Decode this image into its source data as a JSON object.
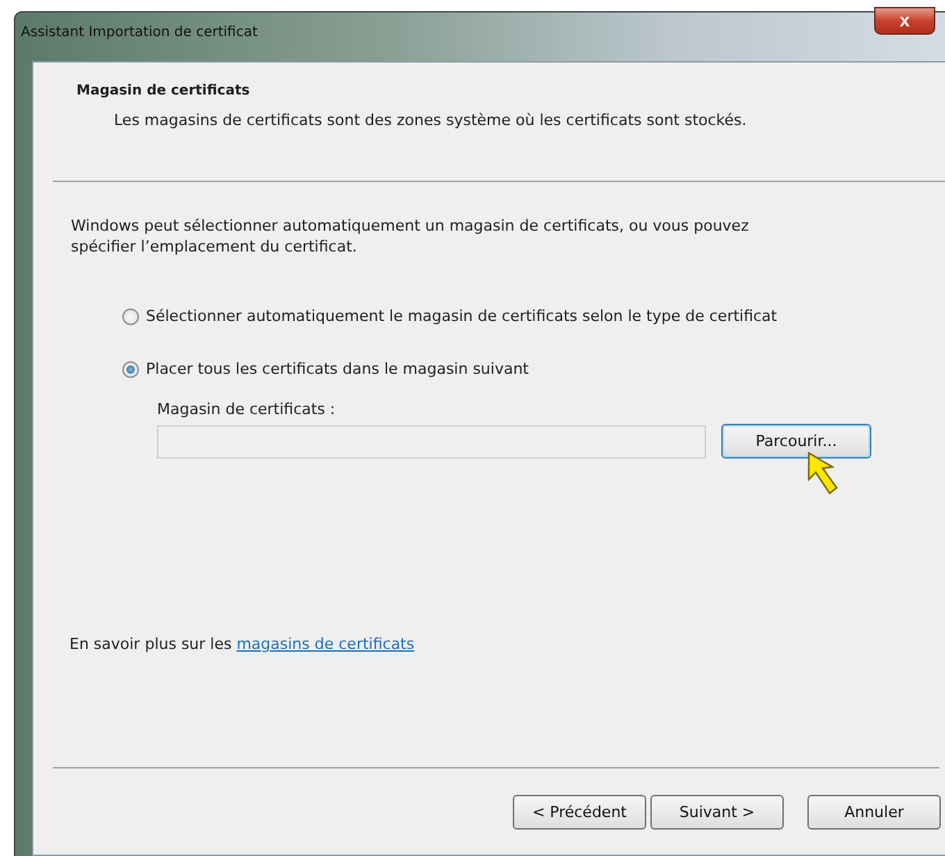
{
  "window": {
    "title": "Assistant Importation de certificat",
    "close": "x"
  },
  "header": {
    "title": "Magasin de certificats",
    "subtitle": "Les magasins de certificats sont des zones système où les certificats sont stockés."
  },
  "intro": "Windows peut sélectionner automatiquement un magasin de certificats, ou vous pouvez spécifier l’emplacement du certificat.",
  "options": [
    {
      "label": "Sélectionner automatiquement le magasin de certificats selon le type de certificat",
      "selected": false
    },
    {
      "label": "Placer tous les certificats dans le magasin suivant",
      "selected": true
    }
  ],
  "store_field": {
    "label": "Magasin de certificats :",
    "browse": "Parcourir..."
  },
  "learn_more": {
    "text": "En savoir plus sur les",
    "link": "magasins de certificats"
  },
  "buttons": [
    "< Précédent",
    "Suivant >",
    "Annuler"
  ]
}
